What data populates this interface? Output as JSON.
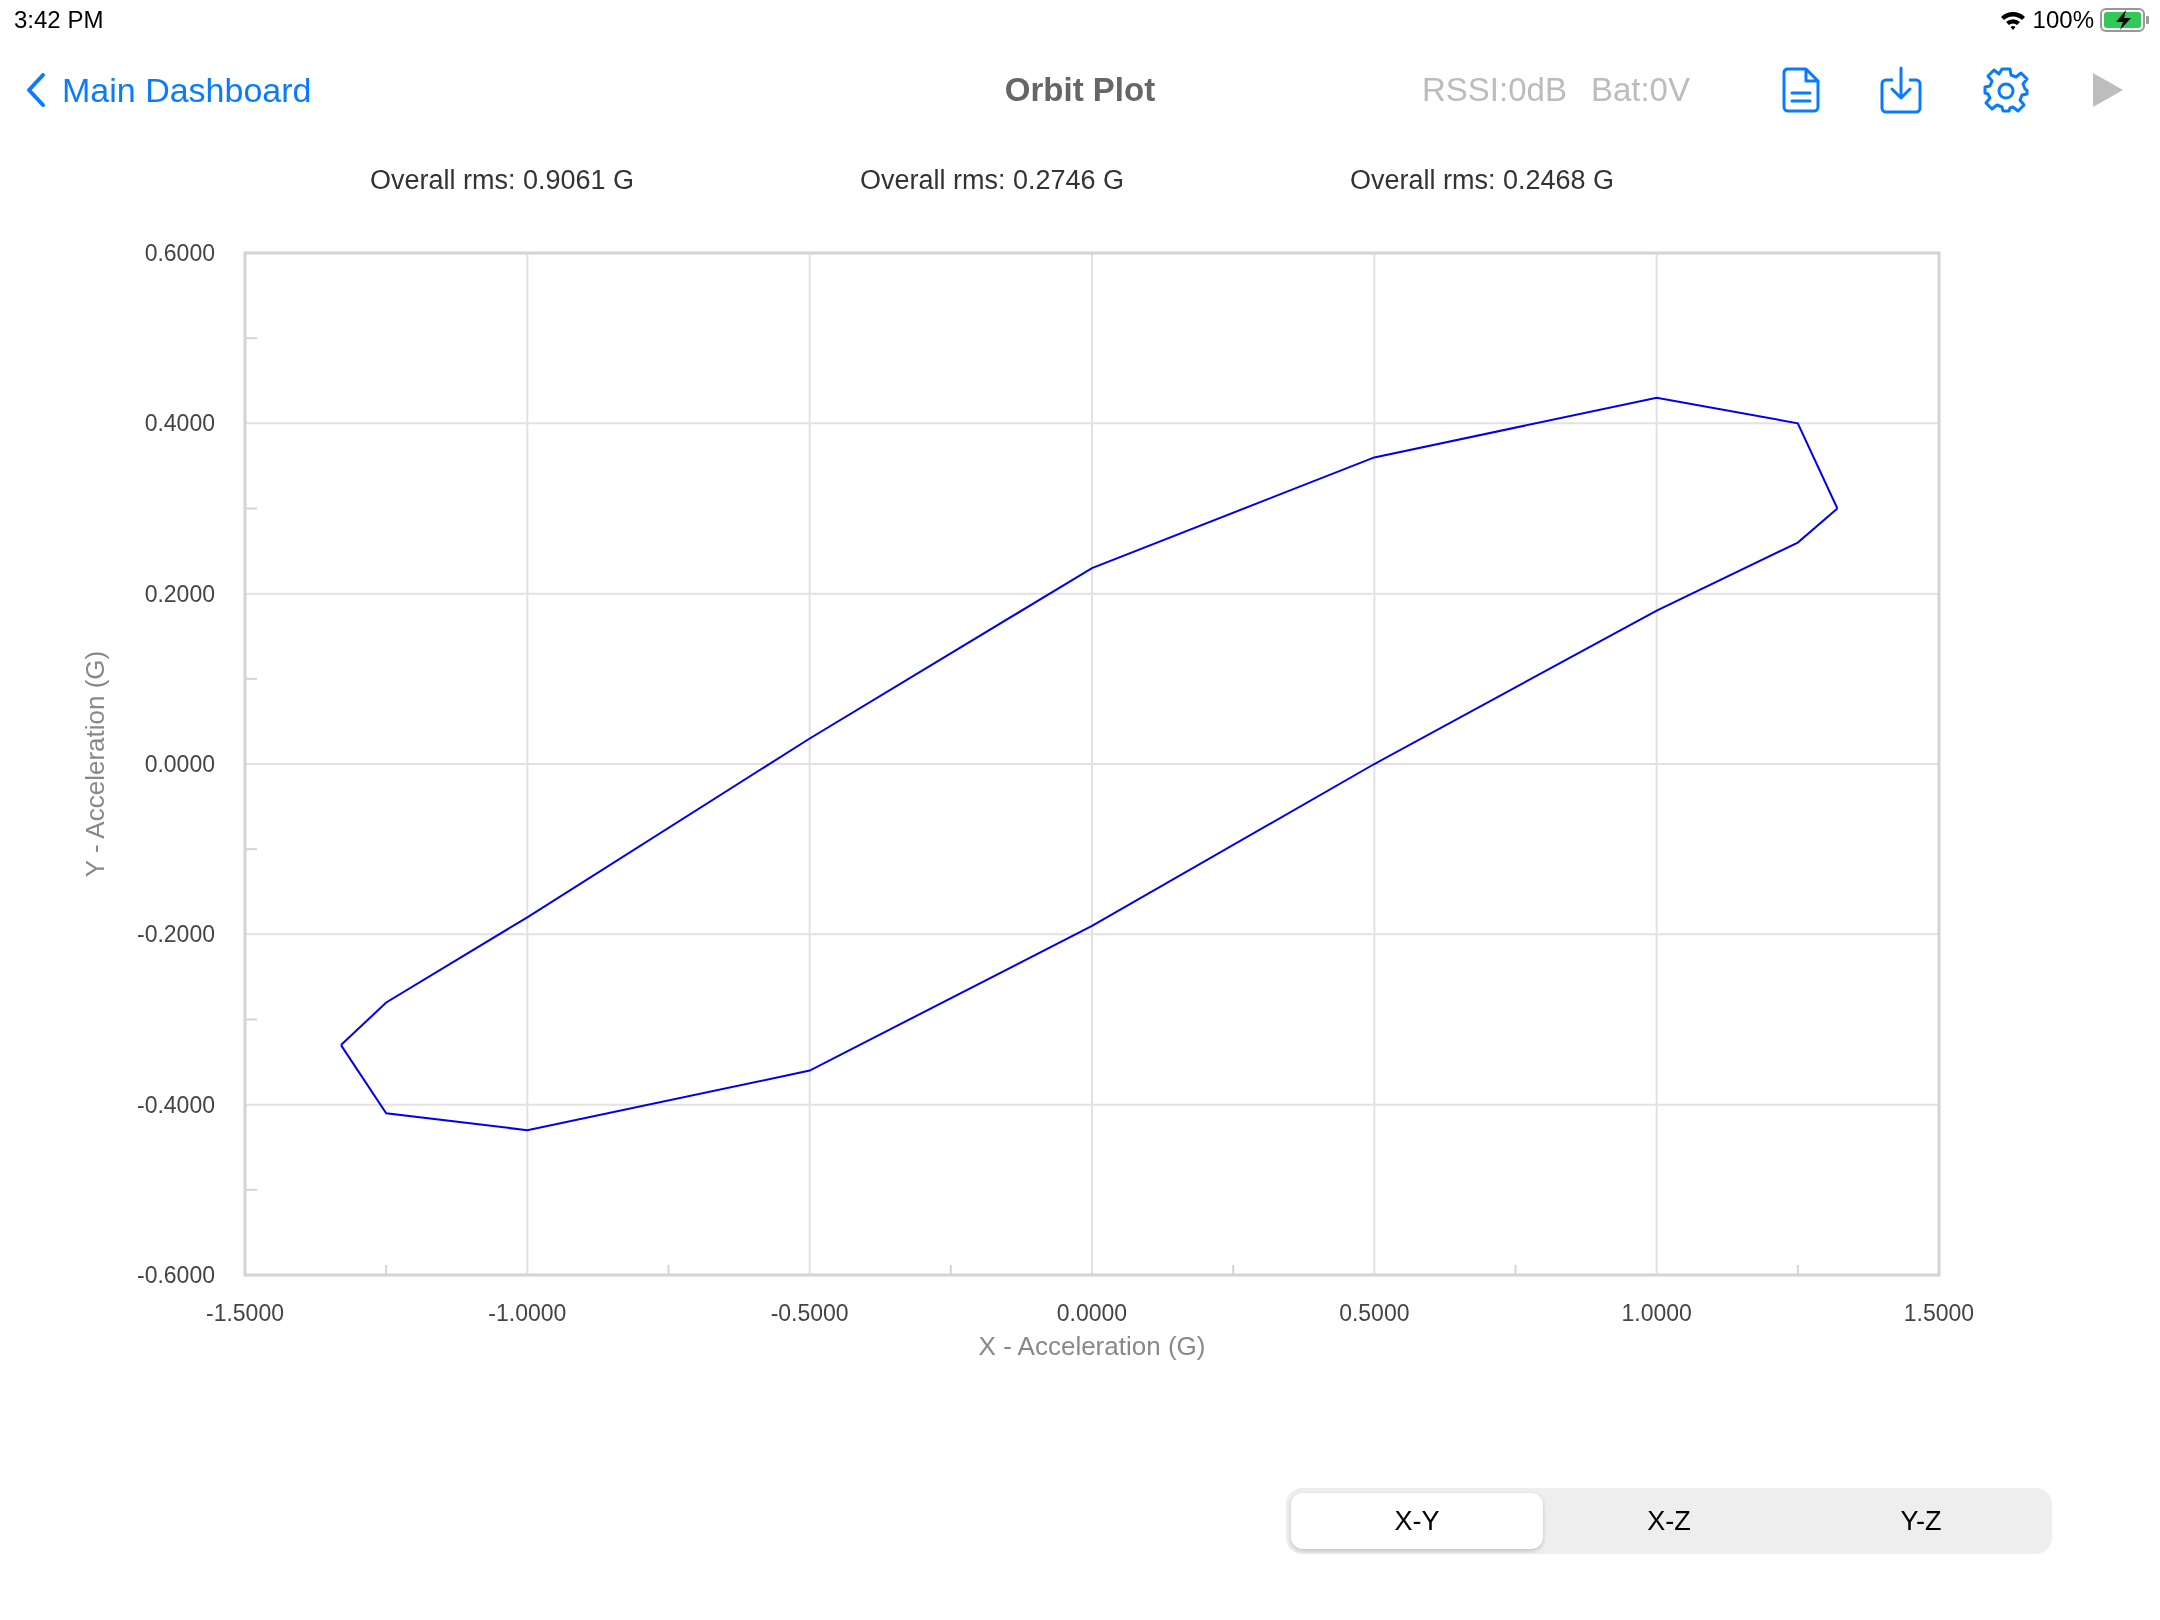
{
  "status_bar": {
    "time": "3:42 PM",
    "battery": "100%"
  },
  "nav_bar": {
    "back_label": "Main Dashboard",
    "title": "Orbit Plot",
    "rssi": "RSSI:0dB",
    "battery_voltage": "Bat:0V",
    "play_disabled": true
  },
  "rms_readings": [
    "Overall rms: 0.9061 G",
    "Overall rms: 0.2746 G",
    "Overall rms: 0.2468 G"
  ],
  "chart": {
    "chart_data": {
      "type": "line",
      "xlabel": "X - Acceleration (G)",
      "ylabel": "Y - Acceleration (G)",
      "xlim": [
        -1.5,
        1.5
      ],
      "ylim": [
        -0.6,
        0.6
      ],
      "xticks": [
        {
          "value": -1.5,
          "label": "-1.5000"
        },
        {
          "value": -1,
          "label": "-1.0000"
        },
        {
          "value": -0.5,
          "label": "-0.5000"
        },
        {
          "value": 0,
          "label": "0.0000"
        },
        {
          "value": 0.5,
          "label": "0.5000"
        },
        {
          "value": 1,
          "label": "1.0000"
        },
        {
          "value": 1.5,
          "label": "1.5000"
        }
      ],
      "yticks": [
        {
          "value": -0.6,
          "label": "-0.6000"
        },
        {
          "value": -0.4,
          "label": "-0.4000"
        },
        {
          "value": -0.2,
          "label": "-0.2000"
        },
        {
          "value": 0,
          "label": "0.0000"
        },
        {
          "value": 0.2,
          "label": "0.2000"
        },
        {
          "value": 0.4,
          "label": "0.4000"
        },
        {
          "value": 0.6,
          "label": "0.6000"
        }
      ],
      "grid": true,
      "x": [
        -1.33,
        -1.25,
        -1.0,
        -0.5,
        0.0,
        0.5,
        1.0,
        1.25,
        1.32
      ],
      "series": [
        {
          "color": "#0000ee",
          "values": [
            -0.33,
            -0.28,
            -0.18,
            0.03,
            0.23,
            0.36,
            0.43,
            0.4,
            0.3
          ]
        },
        {
          "color": "#0000ee",
          "values": [
            -0.33,
            -0.41,
            -0.43,
            -0.36,
            -0.19,
            0.0,
            0.18,
            0.26,
            0.3
          ]
        }
      ]
    }
  },
  "plane_selector": [
    {
      "label": "X-Y",
      "selected": true
    },
    {
      "label": "X-Z",
      "selected": false
    },
    {
      "label": "Y-Z",
      "selected": false
    }
  ]
}
